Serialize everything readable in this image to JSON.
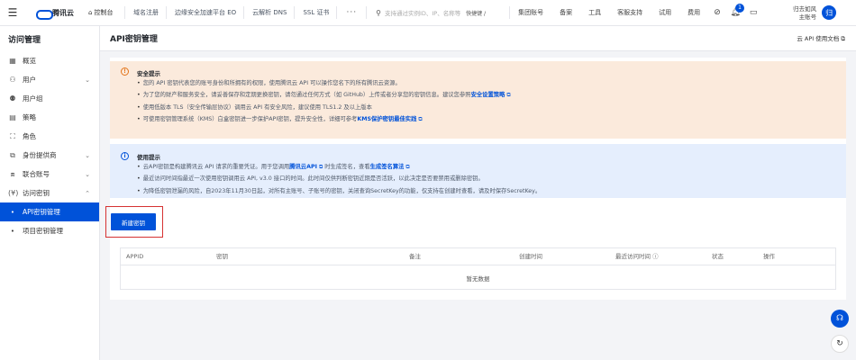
{
  "topbar": {
    "menu_icon": "hamburger-icon",
    "logo_text": "腾讯云",
    "console_label": "控制台",
    "nav": [
      "域名注册",
      "边缘安全加速平台 EO",
      "云解析 DNS",
      "SSL 证书"
    ],
    "more": "···",
    "search_placeholder": "支持通过实例ID、IP、名称等",
    "quick_label": "快捷键 /",
    "right_links": [
      "集团账号",
      "备案",
      "工具",
      "客服支持",
      "试用",
      "费用"
    ],
    "notification_count": "1",
    "user_line1": "归去如风",
    "user_line2": "主账号",
    "avatar_text": "归"
  },
  "sidebar": {
    "title": "访问管理",
    "items": [
      {
        "label": "概览",
        "icon": "grid-icon",
        "chevron": ""
      },
      {
        "label": "用户",
        "icon": "user-icon",
        "chevron": "⌄"
      },
      {
        "label": "用户组",
        "icon": "users-icon",
        "chevron": ""
      },
      {
        "label": "策略",
        "icon": "policy-icon",
        "chevron": ""
      },
      {
        "label": "角色",
        "icon": "role-icon",
        "chevron": ""
      },
      {
        "label": "身份提供商",
        "icon": "idp-icon",
        "chevron": "⌄"
      },
      {
        "label": "联合账号",
        "icon": "federation-icon",
        "chevron": "⌄"
      },
      {
        "label": "访问密钥",
        "icon": "key-icon",
        "chevron": "⌃"
      }
    ],
    "subitems": [
      "API密钥管理",
      "项目密钥管理"
    ]
  },
  "page": {
    "title": "API密钥管理",
    "doc_link": "云 API 使用文档"
  },
  "warning": {
    "title": "安全提示",
    "lines": [
      {
        "pre": "您的 API 密钥代表您的账号身份和所拥有的权限，使用腾讯云 API 可以操作您名下的所有腾讯云资源。",
        "link": "",
        "post": ""
      },
      {
        "pre": "为了您的财产和服务安全，请妥善保存和定期更换密钥，请勿通过任何方式（如 GitHub）上传或者分享您的密钥信息。建议您参照",
        "link": "安全设置策略",
        "post": ""
      },
      {
        "pre": "使用低版本 TLS（安全传输层协议）调用云 API 有安全风险，建议使用 TLS1.2 及以上版本",
        "link": "",
        "post": ""
      },
      {
        "pre": "可使用密钥管理系统（KMS）白盒密钥进一步保护API密钥，提升安全性，详细可参考",
        "link": "KMS保护密钥最佳实践",
        "post": ""
      }
    ]
  },
  "usage": {
    "title": "使用提示",
    "lines": [
      {
        "pre": "云API密钥是构建腾讯云 API 请求的重要凭证。用于您调用",
        "link": "腾讯云API",
        "post": " 时生成签名，查看",
        "link2": "生成签名算法"
      },
      {
        "pre": "最近访问时间指最近一次使用密钥调用云 API, v3.0 接口的时间。此时间仅供判断密钥近期是否活跃，以此决定是否要禁用或删除密钥。",
        "link": "",
        "post": "",
        "link2": ""
      },
      {
        "pre": "为降低密钥泄漏的风险，自2023年11月30日起，对所有主账号、子账号的密钥，关闭查询SecretKey的功能，仅支持在创建时查看，请及时保存SecretKey。",
        "link": "",
        "post": "",
        "link2": ""
      }
    ]
  },
  "new_key_button": "新建密钥",
  "table": {
    "columns": [
      "APPID",
      "密钥",
      "备注",
      "创建时间",
      "最近访问时间",
      "状态",
      "操作"
    ],
    "info_icon": "ⓘ",
    "empty_text": "暂无数据"
  },
  "float": {
    "support_icon": "headset-icon",
    "feedback_icon": "refresh-icon"
  }
}
